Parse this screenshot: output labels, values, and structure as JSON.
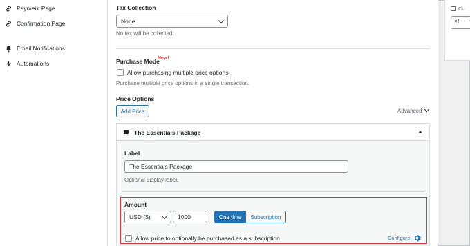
{
  "sidebar": {
    "items": [
      {
        "label": "Payment Page",
        "icon": "link-icon"
      },
      {
        "label": "Confirmation Page",
        "icon": "link-icon"
      },
      {
        "label": "Email Notifications",
        "icon": "bell-icon"
      },
      {
        "label": "Automations",
        "icon": "bolt-icon"
      }
    ]
  },
  "tax": {
    "label": "Tax Collection",
    "value": "None",
    "help": "No tax will be collected."
  },
  "purchase_mode": {
    "label": "Purchase Mode",
    "badge": "New!",
    "checkbox_label": "Allow purchasing multiple price options",
    "help": "Purchase multiple price options in a single transaction."
  },
  "price_options": {
    "label": "Price Options",
    "add_button": "Add Price",
    "advanced": "Advanced"
  },
  "package": {
    "title": "The Essentials Package",
    "label_title": "Label",
    "label_value": "The Essentials Package",
    "label_help": "Optional display label.",
    "amount_title": "Amount",
    "currency": "USD ($)",
    "amount": "1000",
    "one_time": "One time",
    "subscription": "Subscription",
    "subscription_checkbox": "Allow price to optionally be purchased as a subscription",
    "configure": "Configure"
  },
  "right_panel": {
    "header": "Co",
    "code": "<!-- w"
  },
  "colors": {
    "accent": "#2271b1",
    "badge": "#d63638",
    "highlight": "#d63638"
  }
}
